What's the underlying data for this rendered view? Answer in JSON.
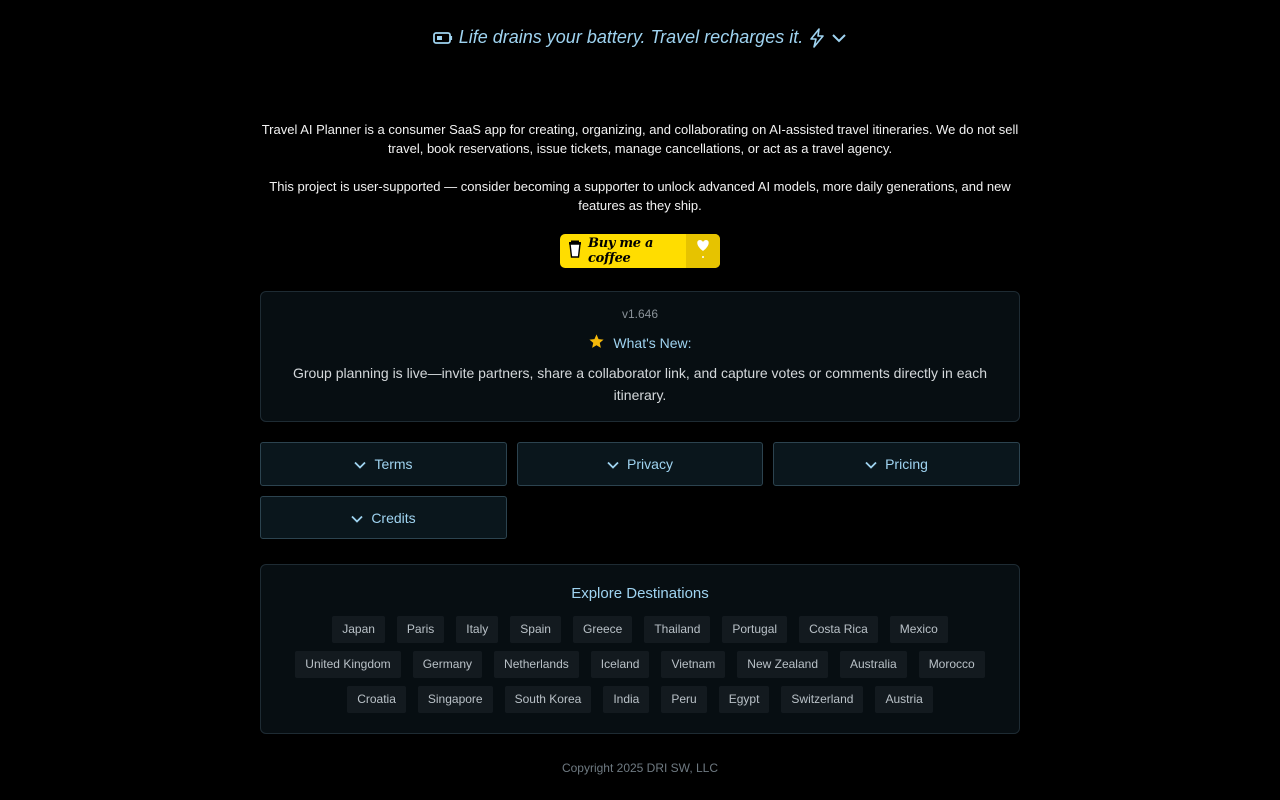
{
  "tagline": {
    "text": "Life drains your battery. Travel recharges it.",
    "icons": [
      "battery-icon",
      "lightning-icon",
      "chevron-down-icon"
    ]
  },
  "about": {
    "paragraph1": "Travel AI Planner is a consumer SaaS app for creating, organizing, and collaborating on AI-assisted travel itineraries. We do not sell travel, book reservations, issue tickets, manage cancellations, or act as a travel agency.",
    "paragraph2": "This project is user-supported — consider becoming a supporter to unlock advanced AI models, more daily generations, and new features as they ship."
  },
  "support": {
    "button_label": "Buy me a coffee",
    "colors": {
      "background": "#ffdd00",
      "accent": "#e6c300"
    }
  },
  "whats_new": {
    "version": "v1.646",
    "heading": "What's New:",
    "description": "Group planning is live—invite partners, share a collaborator link, and capture votes or comments directly in each itinerary."
  },
  "accordions": {
    "terms": "Terms",
    "privacy": "Privacy",
    "pricing": "Pricing",
    "credits": "Credits"
  },
  "destinations": {
    "title": "Explore Destinations",
    "rows": [
      [
        "Japan",
        "Paris",
        "Italy",
        "Spain",
        "Greece",
        "Thailand",
        "Portugal",
        "Costa Rica",
        "Mexico"
      ],
      [
        "United Kingdom",
        "Germany",
        "Netherlands",
        "Iceland",
        "Vietnam",
        "New Zealand",
        "Australia",
        "Morocco"
      ],
      [
        "Croatia",
        "Singapore",
        "South Korea",
        "India",
        "Peru",
        "Egypt",
        "Switzerland",
        "Austria"
      ]
    ]
  },
  "footer": {
    "copyright": "Copyright 2025 DRI SW, LLC"
  },
  "theme": {
    "accent": "#9fd3f0",
    "background": "#000000",
    "card": "#070e12"
  }
}
